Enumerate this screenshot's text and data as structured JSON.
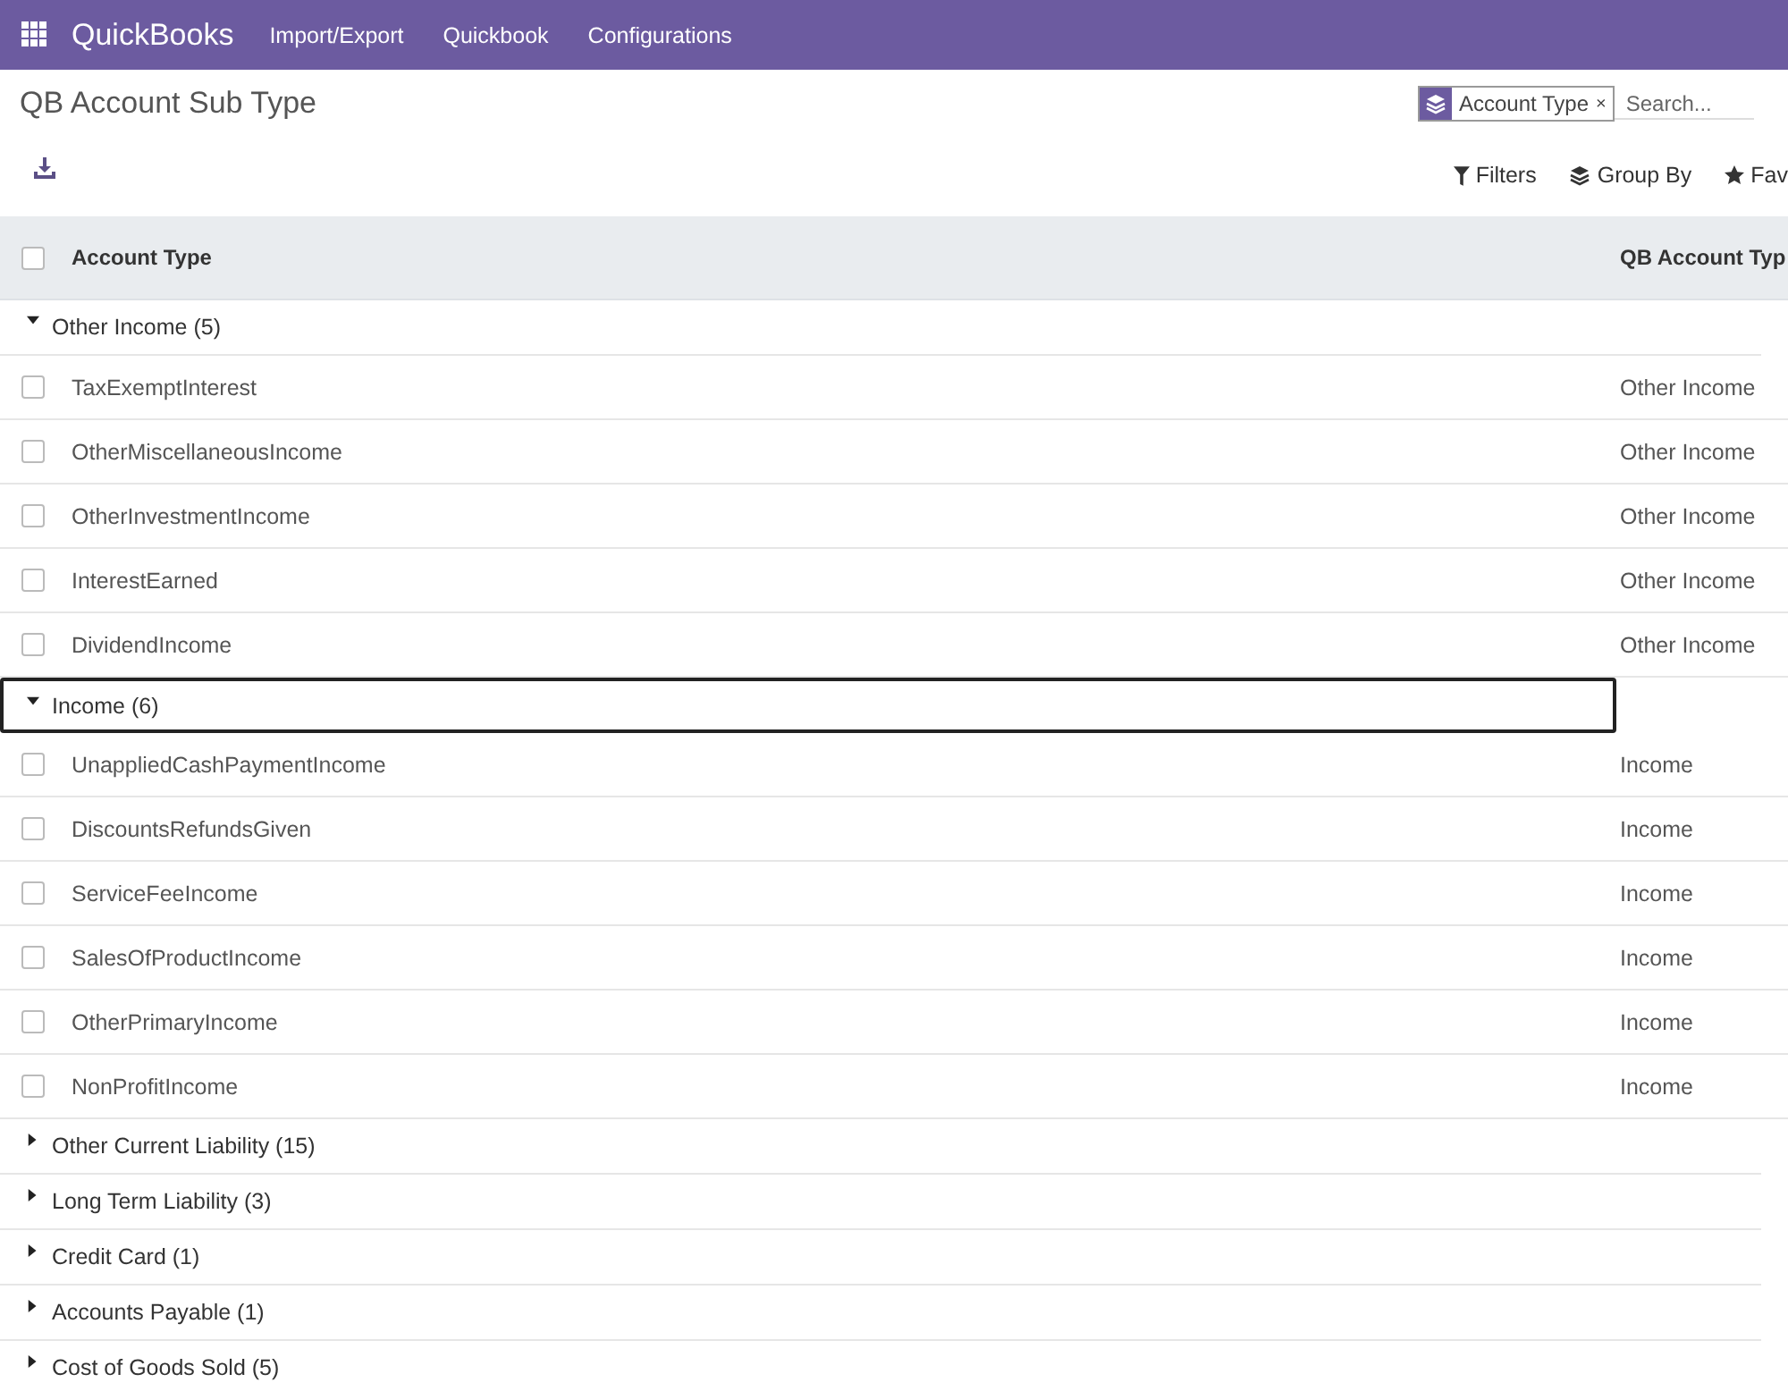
{
  "navbar": {
    "app_name": "QuickBooks",
    "menu": [
      "Import/Export",
      "Quickbook",
      "Configurations"
    ]
  },
  "page_title": "QB Account Sub Type",
  "search": {
    "facet": "Account Type",
    "facet_remove": "×",
    "placeholder": "Search..."
  },
  "search_options": [
    "Filters",
    "Group By",
    "Fav"
  ],
  "table": {
    "columns": [
      "Account Type",
      "QB Account Typ"
    ],
    "header_checked": false,
    "groups": [
      {
        "label": "Other Income (5)",
        "expanded": true,
        "focused": false,
        "rows": [
          {
            "name": "TaxExemptInterest",
            "type": "Other Income",
            "checked": false
          },
          {
            "name": "OtherMiscellaneousIncome",
            "type": "Other Income",
            "checked": false
          },
          {
            "name": "OtherInvestmentIncome",
            "type": "Other Income",
            "checked": false
          },
          {
            "name": "InterestEarned",
            "type": "Other Income",
            "checked": false
          },
          {
            "name": "DividendIncome",
            "type": "Other Income",
            "checked": false
          }
        ]
      },
      {
        "label": "Income (6)",
        "expanded": true,
        "focused": true,
        "rows": [
          {
            "name": "UnappliedCashPaymentIncome",
            "type": "Income",
            "checked": false
          },
          {
            "name": "DiscountsRefundsGiven",
            "type": "Income",
            "checked": false
          },
          {
            "name": "ServiceFeeIncome",
            "type": "Income",
            "checked": false
          },
          {
            "name": "SalesOfProductIncome",
            "type": "Income",
            "checked": false
          },
          {
            "name": "OtherPrimaryIncome",
            "type": "Income",
            "checked": false
          },
          {
            "name": "NonProfitIncome",
            "type": "Income",
            "checked": false
          }
        ]
      },
      {
        "label": "Other Current Liability (15)",
        "expanded": false,
        "focused": false
      },
      {
        "label": "Long Term Liability (3)",
        "expanded": false,
        "focused": false
      },
      {
        "label": "Credit Card (1)",
        "expanded": false,
        "focused": false
      },
      {
        "label": "Accounts Payable (1)",
        "expanded": false,
        "focused": false
      },
      {
        "label": "Cost of Goods Sold (5)",
        "expanded": false,
        "focused": false
      }
    ]
  }
}
